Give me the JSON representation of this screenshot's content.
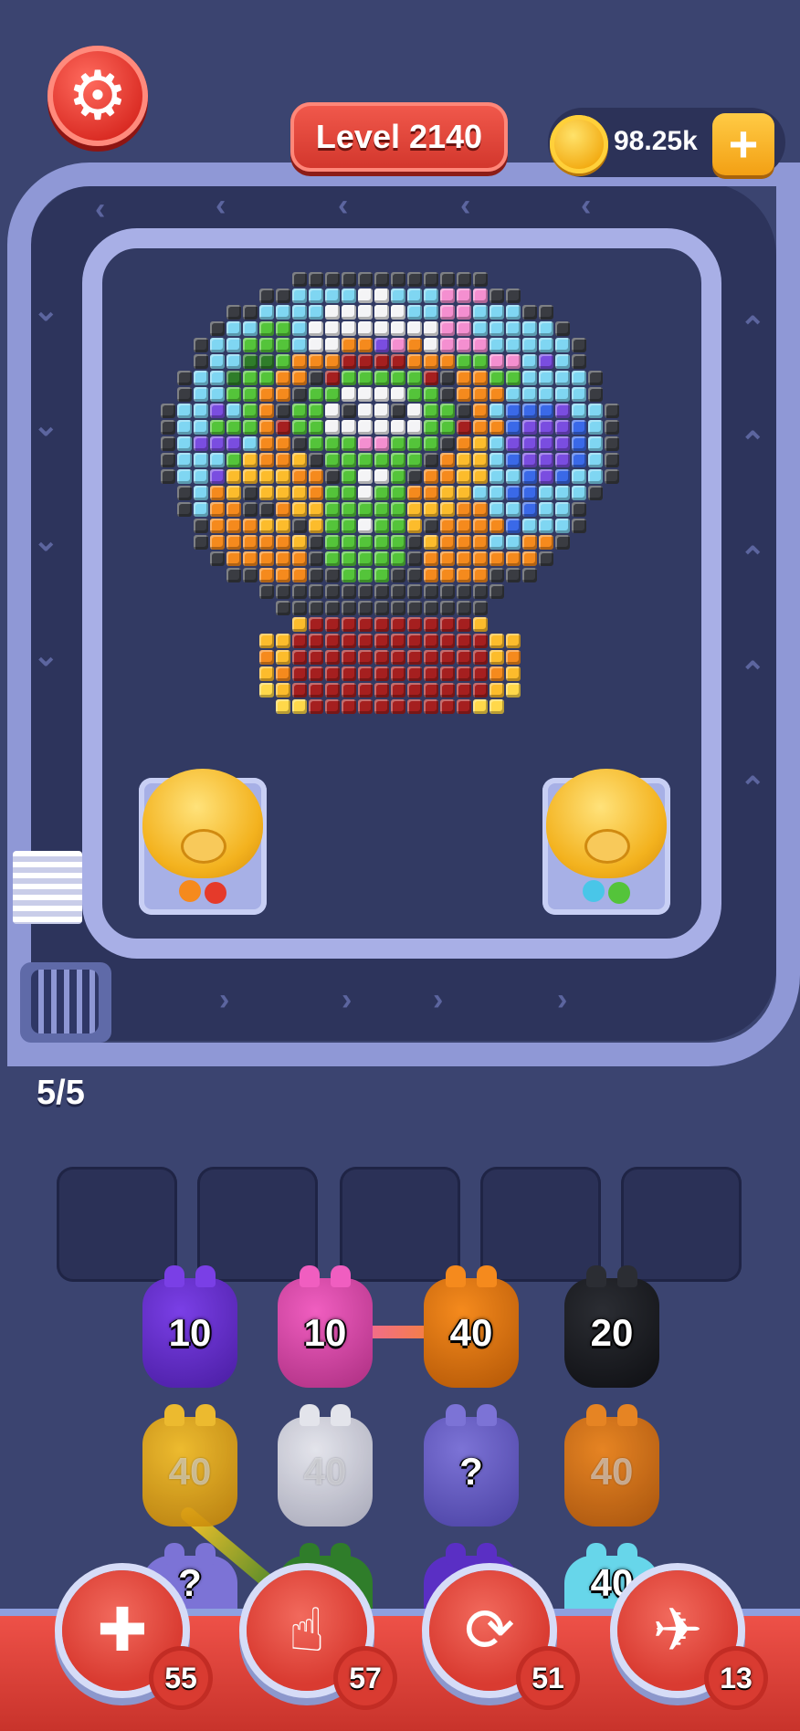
{
  "header": {
    "settings_icon": "gear-icon",
    "level_label": "Level 2140",
    "coins": "98.25k",
    "coin_add": "+"
  },
  "belt": {
    "capacity_text": "5/5"
  },
  "board": {
    "palette": {
      "0": "",
      "K": "#3a3c42",
      "C": "#7fd6f2",
      "W": "#f4f4f6",
      "P": "#f48fd0",
      "G": "#54c43a",
      "D": "#2f7d2a",
      "O": "#f58a1d",
      "Y": "#fcbc2c",
      "U": "#7a4de0",
      "B": "#3a69e8",
      "R": "#a51f1f",
      "L": "#ffd84a"
    },
    "rows": [
      "0000000000KKKKKKKKKKKK0000000000",
      "00000000KKCCCCWWCCCPPPKK00000000",
      "000000KKCCCCWWWWWCCPPCCCKK000000",
      "00000KCCGGCWWWWWWWWPPCCCCCK00000",
      "0000KCCGGGCWWOOUPOWPPPCCCCCK0000",
      "0000KCCDDGOOORRRROOOGGPPCUCK0000",
      "000KCCDGGOOKRGGGGGRKOOGGCCCCK000",
      "000KCCGGOOKGGWWWWGGKOOOCCCCCK000",
      "00KCCUCGOKGGWKWWKWGGKOCBBBUCCK00",
      "00KCCGGGORGGWWWWWWGGROOBUUUBCK00",
      "00KCUUUCOOKGGGPPGGGKOYCUUUUBCK00",
      "00KCCCGYOOYKGGGGGGKOYYCBUUUBCK00",
      "00KCCUYYYYOOKGWWGKOOYYCCBUBCCK00",
      "000KCOYKYYYOGGWGGOOYYCCBBCCCK000",
      "000KCOOKKOYYGGGGGYYYOOCCBCCK0000",
      "0000KOOOYYKYGGWGGYKOOOOBCCCK0000",
      "0000KOOOOOYKGGGGGKYOOOCCOOK00000",
      "00000KOOOOOKGGGGGKOOOOOOOK000000",
      "000000KKOOOKKGGGKKOOOOKKK0000000",
      "00000000KKKKKKKKKKKKKKK000000000",
      "000000000KKKKKKKKKKKKK0000000000",
      "0000000000YRRRRRRRRRRY0000000000",
      "00000000YYRRRRRRRRRRRRYY00000000",
      "00000000OYRRRRRRRRRRRRYO00000000",
      "00000000YORRRRRRRRRRRROY00000000",
      "00000000LYRRRRRRRRRRRRYL00000000",
      "000000000LLRRRRRRRRRRLL000000000"
    ],
    "left_pig_balls": [
      "#f58a1d",
      "#e53a2a"
    ],
    "right_pig_balls": [
      "#49c6e8",
      "#54c43a"
    ]
  },
  "slots": [
    "",
    "",
    "",
    "",
    ""
  ],
  "piggies": {
    "row1": [
      {
        "num": "10",
        "color": "#7a3fe6",
        "dark": "#4e20a8"
      },
      {
        "num": "10",
        "color": "#f05ec0",
        "dark": "#b23387"
      },
      {
        "num": "40",
        "color": "#f58a1d",
        "dark": "#b85b08"
      },
      {
        "num": "20",
        "color": "#2b2d33",
        "dark": "#111216"
      }
    ],
    "row2": [
      {
        "num": "40",
        "color": "#fcc52a",
        "dark": "#c88a0a"
      },
      {
        "num": "40",
        "color": "#f2f2f6",
        "dark": "#b7b7c4"
      },
      {
        "num": "?",
        "color": "#7c73d6",
        "dark": "#4f46a8"
      },
      {
        "num": "40",
        "color": "#f58a1d",
        "dark": "#b85b08"
      }
    ],
    "row3": [
      {
        "num": "?",
        "color": "#7c73d6"
      },
      {
        "num": "",
        "color": "#2f7d2a"
      },
      {
        "num": "",
        "color": "#5a2fc4"
      },
      {
        "num": "40",
        "color": "#67d6ea"
      }
    ]
  },
  "boosters": [
    {
      "name": "add-slot",
      "icon": "✚",
      "count": "55"
    },
    {
      "name": "tap",
      "icon": "☝",
      "count": "57"
    },
    {
      "name": "shuffle",
      "icon": "⟳",
      "count": "51"
    },
    {
      "name": "vacuum",
      "icon": "✈",
      "count": "13"
    }
  ]
}
